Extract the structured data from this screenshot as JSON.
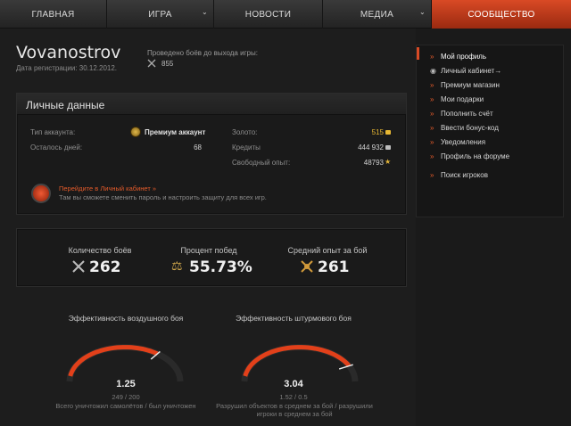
{
  "nav": {
    "items": [
      {
        "label": "ГЛАВНАЯ",
        "dropdown": false,
        "active": false
      },
      {
        "label": "ИГРА",
        "dropdown": true,
        "active": false
      },
      {
        "label": "НОВОСТИ",
        "dropdown": false,
        "active": false
      },
      {
        "label": "МЕДИА",
        "dropdown": true,
        "active": false
      },
      {
        "label": "СООБЩЕСТВО",
        "dropdown": false,
        "active": true
      }
    ]
  },
  "profile": {
    "username": "Vovanostrov",
    "registration": "Дата регистрации: 30.12.2012.",
    "battles_since_label": "Проведено боёв до выхода игры:",
    "battles_since_value": "855"
  },
  "personal": {
    "title": "Личные данные",
    "account_type_label": "Тип аккаунта:",
    "account_type_value": "Премиум аккаунт",
    "days_left_label": "Осталось дней:",
    "days_left_value": "68",
    "gold_label": "Золото:",
    "gold_value": "515",
    "credits_label": "Кредиты",
    "credits_value": "444 932",
    "free_xp_label": "Свободный опыт:",
    "free_xp_value": "48793",
    "cabinet_link": "Перейдите в Личный кабинет »",
    "cabinet_hint": "Там вы сможете сменить пароль и настроить защиту для всех игр."
  },
  "stats": {
    "battles_label": "Количество боёв",
    "battles_value": "262",
    "winrate_label": "Процент побед",
    "winrate_value": "55.73%",
    "avg_xp_label": "Средний опыт за бой",
    "avg_xp_value": "261"
  },
  "gauges": {
    "air": {
      "title": "Эффективность воздушного боя",
      "value": "1.25",
      "sub": "249 / 200",
      "desc": "Всего уничтожил самолётов / был уничтожен",
      "level": 0.7
    },
    "assault": {
      "title": "Эффективность штурмового боя",
      "value": "3.04",
      "sub": "1.52 / 0.5",
      "desc_line1": "Разрушил объектов в среднем за бой / разрушили",
      "desc_line2": "игроки в среднем за бой",
      "level": 0.85
    }
  },
  "sidebar": {
    "items": [
      {
        "label": "Мой профиль",
        "active": true
      },
      {
        "label": "Личный кабинет→",
        "active": false
      },
      {
        "label": "Премиум магазин",
        "active": false
      },
      {
        "label": "Мои подарки",
        "active": false
      },
      {
        "label": "Пополнить счёт",
        "active": false
      },
      {
        "label": "Ввести бонус-код",
        "active": false
      },
      {
        "label": "Уведомления",
        "active": false
      },
      {
        "label": "Профиль на форуме",
        "active": false
      },
      {
        "label": "Поиск игроков",
        "active": false
      }
    ]
  },
  "colors": {
    "accent": "#d94a25",
    "link": "#e25a2a",
    "gold": "#e8b833"
  }
}
